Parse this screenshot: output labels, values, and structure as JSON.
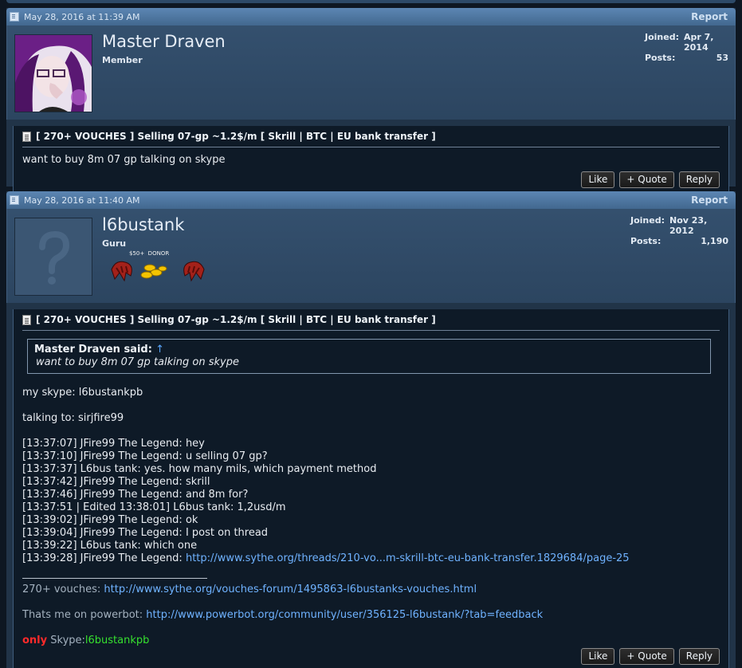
{
  "posts": [
    {
      "date": "May 28, 2016 at 11:39 AM",
      "report": "Report",
      "username": "Master Draven",
      "usertitle": "Member",
      "joined_label": "Joined:",
      "joined": "Apr 7, 2014",
      "posts_label": "Posts:",
      "posts": "53",
      "thread_title": "[ 270+ VOUCHES ] Selling 07-gp ~1.2$/m [ Skrill | BTC | EU bank transfer ]",
      "message": "want to buy 8m 07 gp talking on skype",
      "buttons": {
        "like": "Like",
        "quote": "+ Quote",
        "reply": "Reply"
      }
    },
    {
      "date": "May 28, 2016 at 11:40 AM",
      "report": "Report",
      "username": "l6bustank",
      "usertitle": "Guru",
      "badge_label": "$50+  DONOR",
      "joined_label": "Joined:",
      "joined": "Nov 23, 2012",
      "posts_label": "Posts:",
      "posts": "1,190",
      "thread_title": "[ 270+ VOUCHES ] Selling 07-gp ~1.2$/m [ Skrill | BTC | EU bank transfer ]",
      "quote": {
        "author": "Master Draven said:",
        "arrow": "↑",
        "text": "want to buy 8m 07 gp talking on skype"
      },
      "skype_line": "my skype: l6bustankpb",
      "talking_line": "talking to: sirjfire99",
      "chat": [
        "[13:37:07] JFire99 The Legend: hey",
        "[13:37:10] JFire99 The Legend: u selling 07 gp?",
        "[13:37:37] L6bus tank: yes. how many mils, which payment method",
        "[13:37:42] JFire99 The Legend: skrill",
        "[13:37:46] JFire99 The Legend: and 8m for?",
        "[13:37:51 | Edited 13:38:01] L6bus tank: 1,2usd/m",
        "[13:39:02] JFire99 The Legend: ok",
        "[13:39:04] JFire99 The Legend: I post on thread",
        "[13:39:22] L6bus tank: which one"
      ],
      "chat_last_prefix": "[13:39:28] JFire99 The Legend: ",
      "chat_last_link": "http://www.sythe.org/threads/210-vo...m-skrill-btc-eu-bank-transfer.1829684/page-25",
      "sig": {
        "vouches_prefix": "270+ vouches: ",
        "vouches_link": "http://www.sythe.org/vouches-forum/1495863-l6bustanks-vouches.html",
        "powerbot_prefix": "Thats me on powerbot: ",
        "powerbot_link": "http://www.powerbot.org/community/user/356125-l6bustank/?tab=feedback",
        "only": "only",
        "skype_label": " Skype:",
        "skype_value": "l6bustankpb"
      },
      "buttons": {
        "like": "Like",
        "quote": "+ Quote",
        "reply": "Reply"
      }
    }
  ]
}
